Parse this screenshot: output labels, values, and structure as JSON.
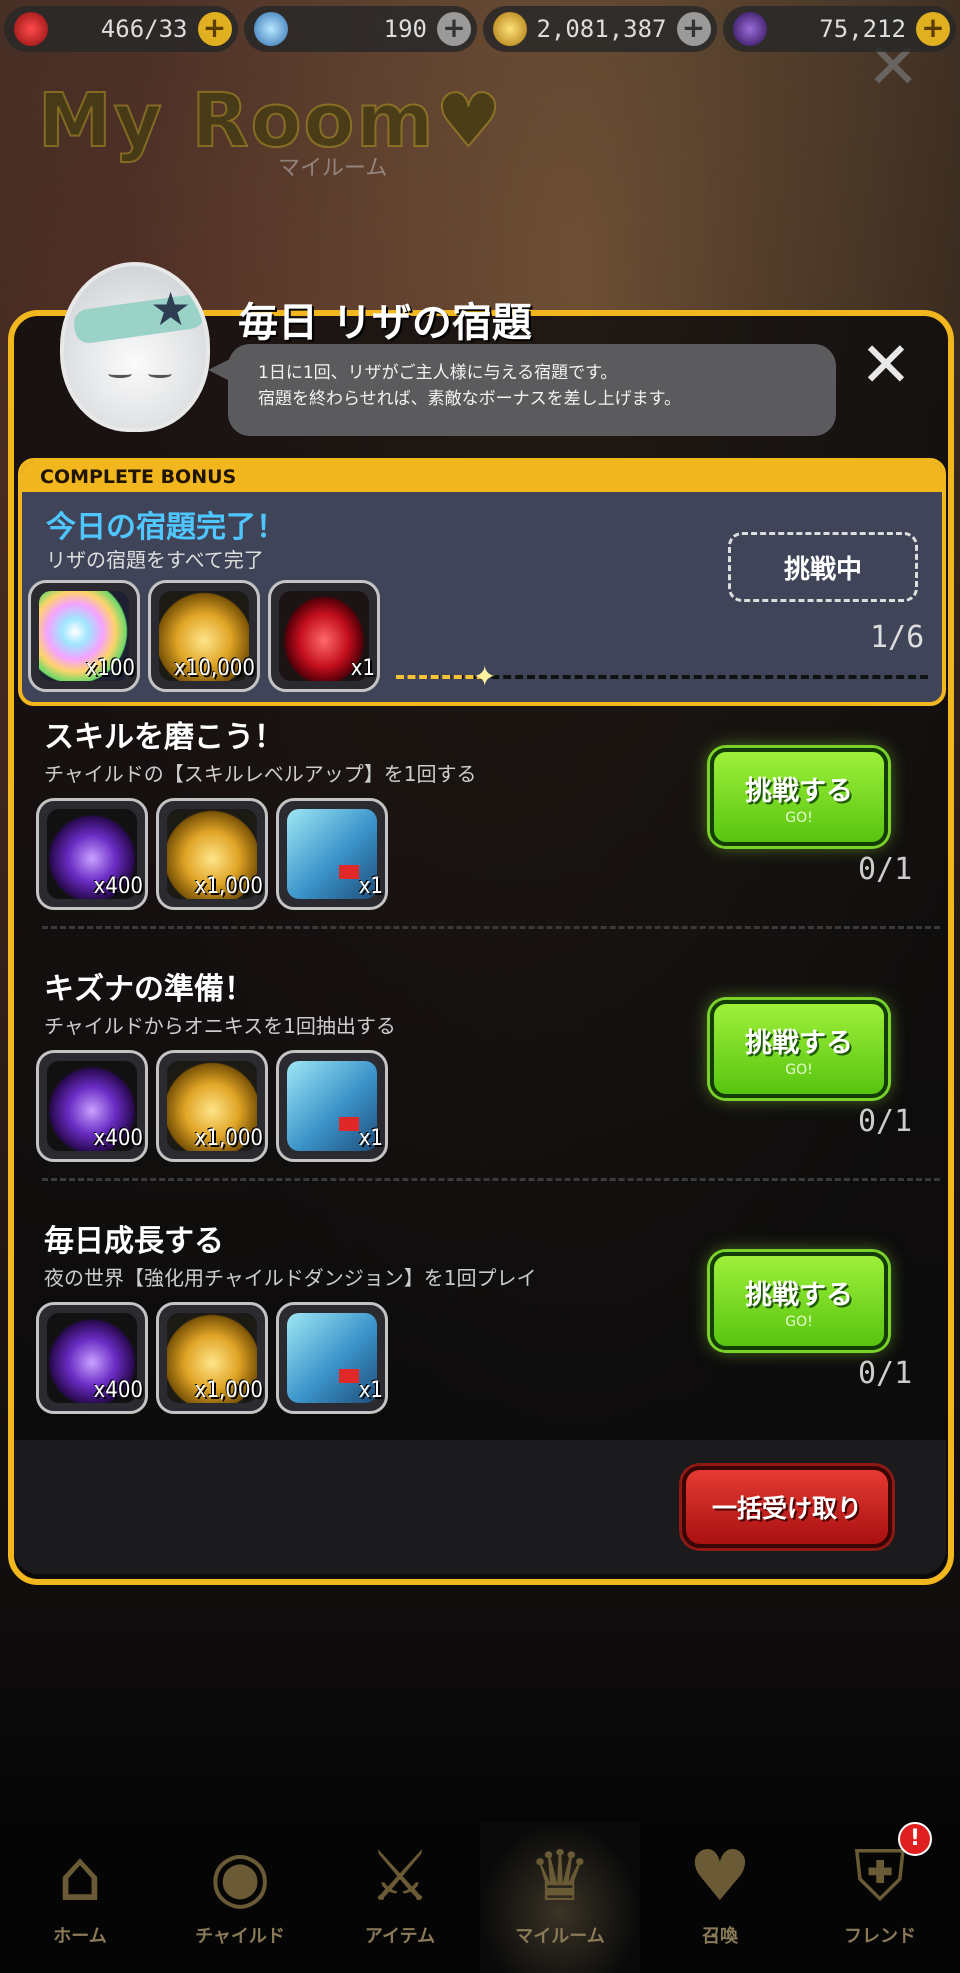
{
  "resources": [
    {
      "name": "stamina",
      "value": "466/33",
      "icon": "heart-icon",
      "color": "#d7262a",
      "plus": "gold"
    },
    {
      "name": "crystal",
      "value": "190",
      "icon": "crystal-pile-icon",
      "color": "#6fb6e8",
      "plus": "grey"
    },
    {
      "name": "gold",
      "value": "2,081,387",
      "icon": "gold-coin-icon",
      "color": "#d9a21c",
      "plus": "grey"
    },
    {
      "name": "onyx",
      "value": "75,212",
      "icon": "dark-heart-gem-icon",
      "color": "#4a2a7a",
      "plus": "gold"
    }
  ],
  "room": {
    "title": "My Room♥",
    "subtitle": "マイルーム"
  },
  "panel": {
    "title": "毎日 リザの宿題",
    "bubble_line1": "1日に1回、リザがご主人様に与える宿題です。",
    "bubble_line2": "宿題を終わらせれば、素敵なボーナスを差し上げます。"
  },
  "complete_bonus": {
    "tag": "COMPLETE BONUS",
    "title": "今日の宿題完了！",
    "description": "リザの宿題をすべて完了",
    "button": "挑戦中",
    "progress": "1/6",
    "progress_fraction": 0.1667,
    "rewards": [
      {
        "icon": "rainbow-gem-icon",
        "qty": "x100",
        "art": "art-rainbow"
      },
      {
        "icon": "gold-coins-icon",
        "qty": "x10,000",
        "art": "art-gold"
      },
      {
        "icon": "red-crystal-icon",
        "qty": "x1",
        "art": "art-ruby"
      }
    ]
  },
  "tasks": [
    {
      "title": "スキルを磨こう！",
      "description": "チャイルドの【スキルレベルアップ】を1回する",
      "button": "挑戦する",
      "button_sub": "GO!",
      "progress": "0/1",
      "rewards": [
        {
          "icon": "onyx-heart-icon",
          "qty": "x400",
          "art": "art-heart"
        },
        {
          "icon": "gold-coins-icon",
          "qty": "x1,000",
          "art": "art-gold"
        },
        {
          "icon": "card-icon",
          "qty": "x1",
          "art": "art-card"
        }
      ]
    },
    {
      "title": "キズナの準備！",
      "description": "チャイルドからオニキスを1回抽出する",
      "button": "挑戦する",
      "button_sub": "GO!",
      "progress": "0/1",
      "rewards": [
        {
          "icon": "onyx-heart-icon",
          "qty": "x400",
          "art": "art-heart"
        },
        {
          "icon": "gold-coins-icon",
          "qty": "x1,000",
          "art": "art-gold"
        },
        {
          "icon": "card-icon",
          "qty": "x1",
          "art": "art-card"
        }
      ]
    },
    {
      "title": "毎日成長する",
      "description": "夜の世界【強化用チャイルドダンジョン】を1回プレイ",
      "button": "挑戦する",
      "button_sub": "GO!",
      "progress": "0/1",
      "rewards": [
        {
          "icon": "onyx-heart-icon",
          "qty": "x400",
          "art": "art-heart"
        },
        {
          "icon": "gold-coins-icon",
          "qty": "x1,000",
          "art": "art-gold"
        },
        {
          "icon": "card-icon",
          "qty": "x1",
          "art": "art-card"
        }
      ]
    }
  ],
  "claim_all": "一括受け取り",
  "nav": [
    {
      "label": "ホーム",
      "icon": "house-icon",
      "glyph": "⌂",
      "active": false
    },
    {
      "label": "チャイルド",
      "icon": "flame-eye-icon",
      "glyph": "◉",
      "active": false
    },
    {
      "label": "アイテム",
      "icon": "sword-shield-icon",
      "glyph": "⚔",
      "active": false
    },
    {
      "label": "マイルーム",
      "icon": "crown-icon",
      "glyph": "♛",
      "active": true
    },
    {
      "label": "召喚",
      "icon": "potion-heart-icon",
      "glyph": "♥",
      "active": false
    },
    {
      "label": "フレンド",
      "icon": "shield-icon",
      "glyph": "⛨",
      "active": false,
      "badge": "!"
    }
  ]
}
